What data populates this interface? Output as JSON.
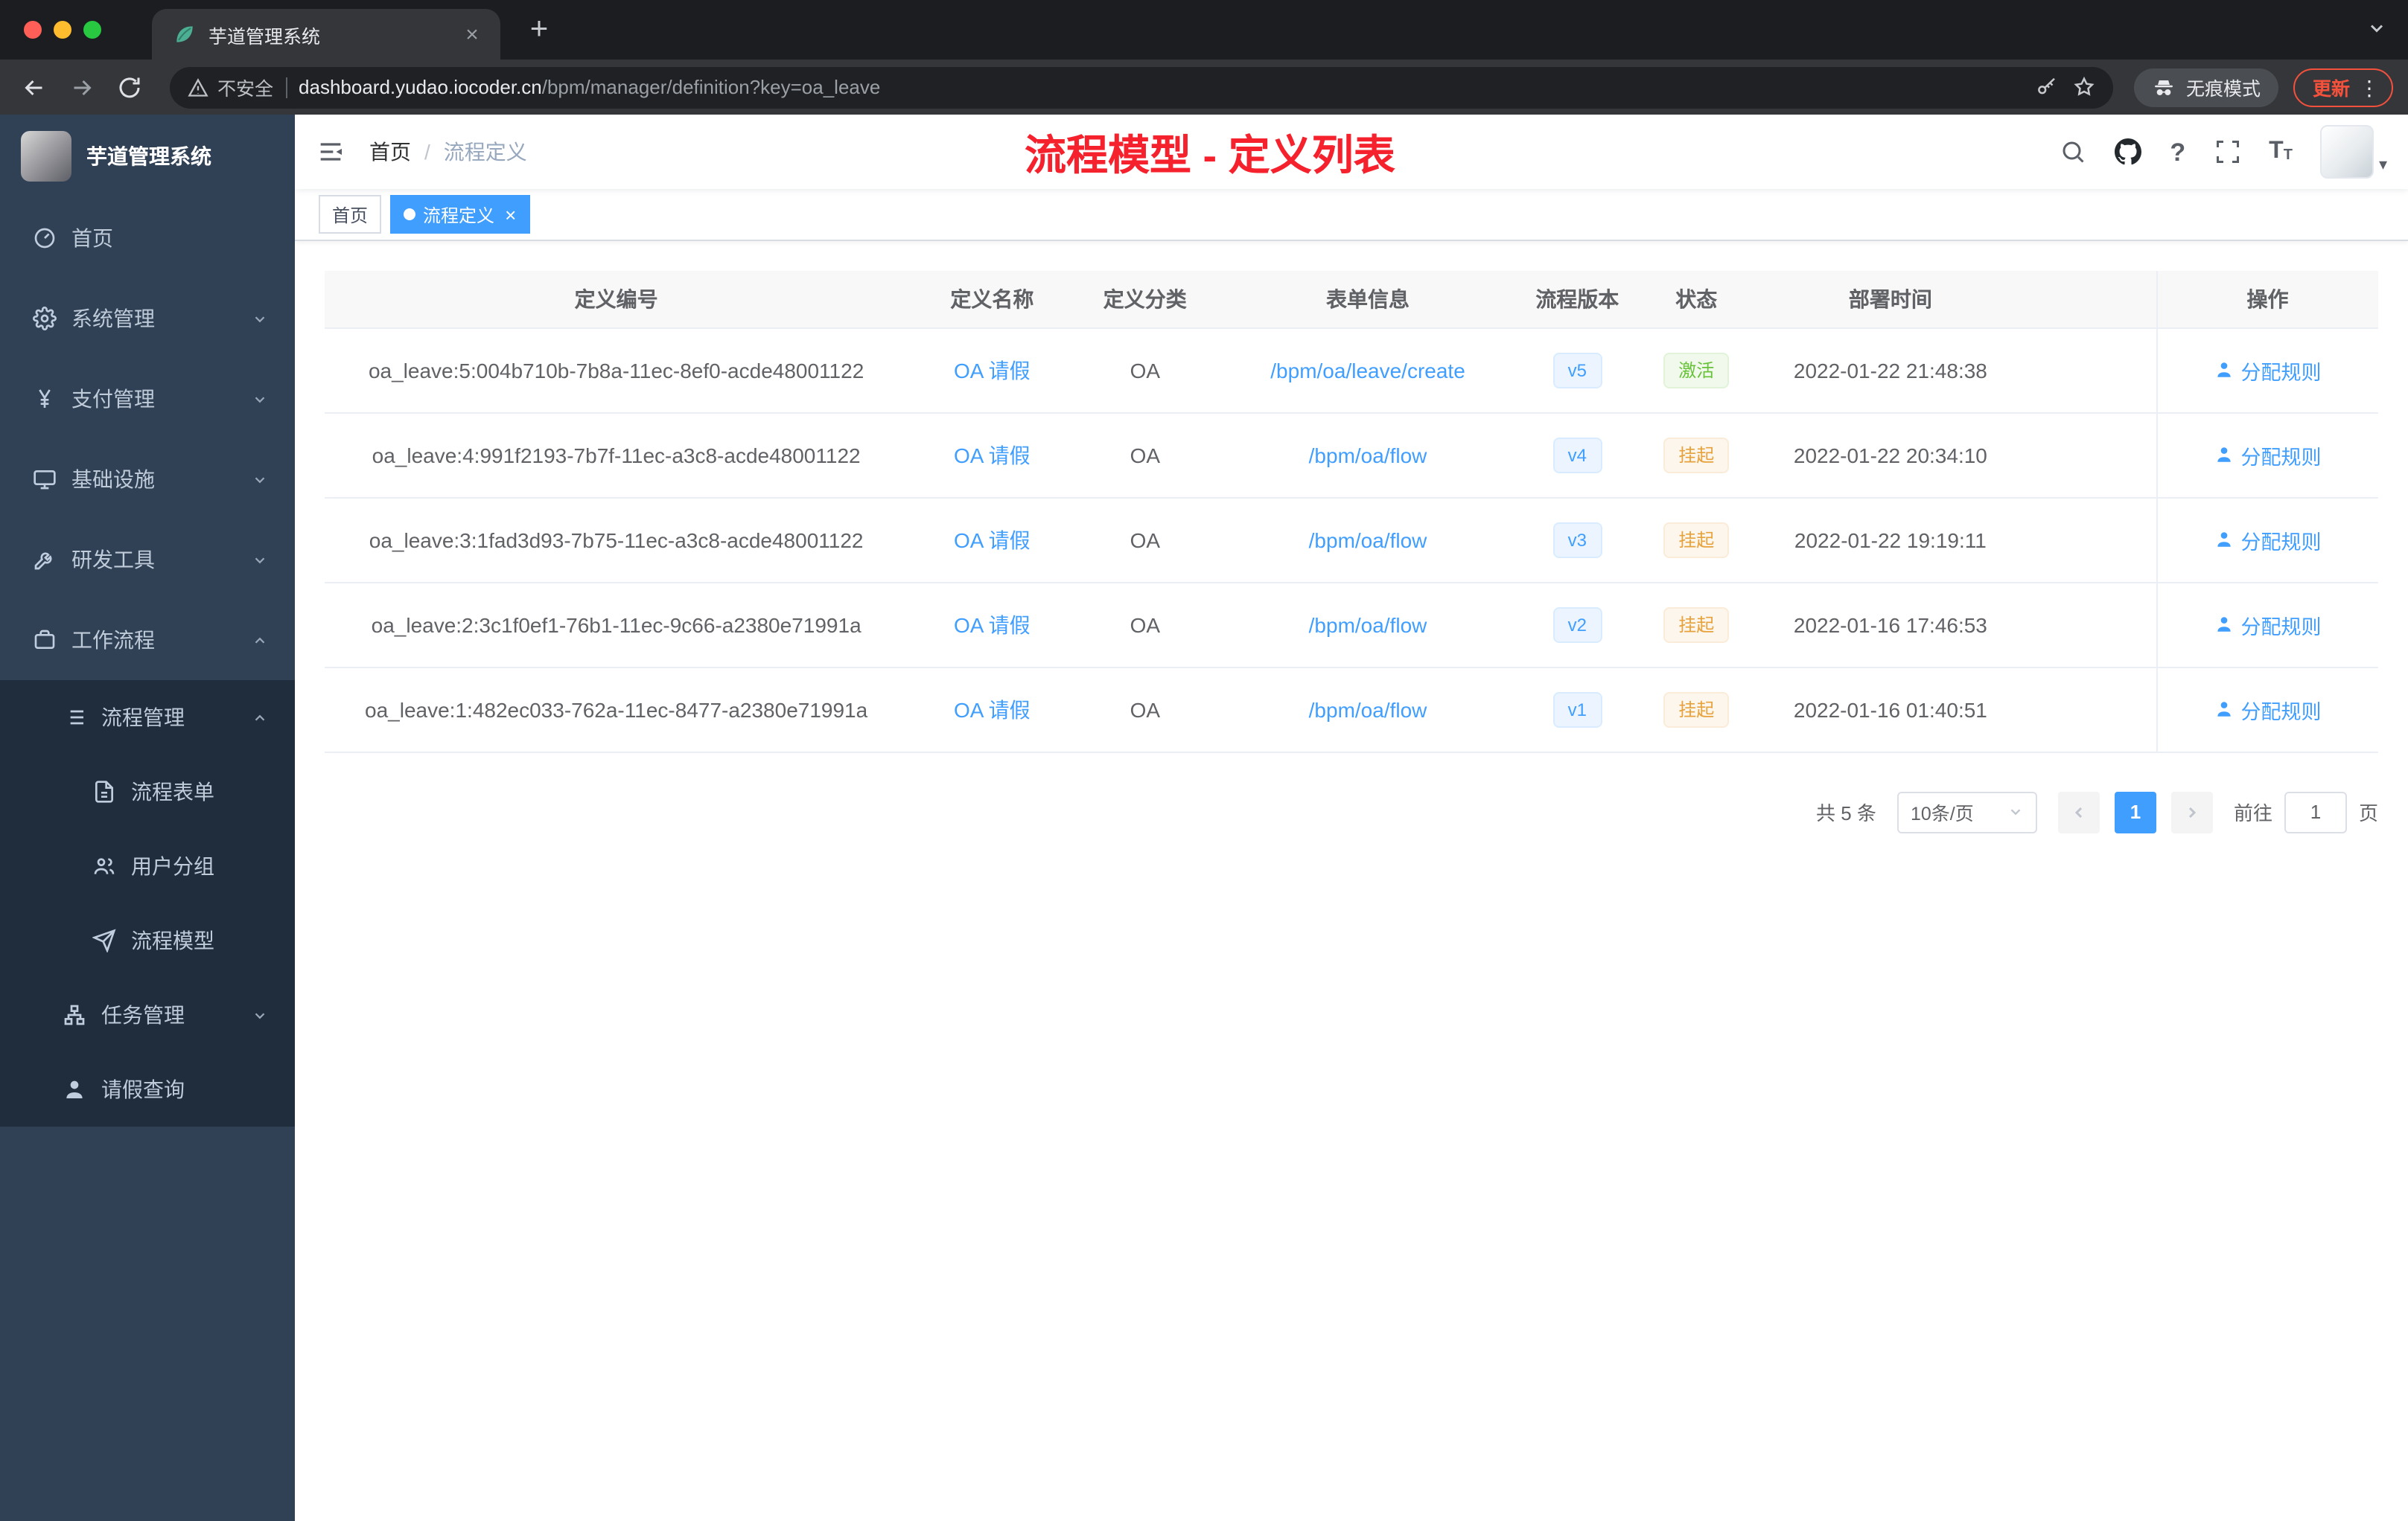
{
  "colors": {
    "accent_blue": "#409eff",
    "annotation_red": "#f5222d",
    "success_green": "#67c23a",
    "warning_orange": "#e6a23c",
    "sidebar_bg": "#304156",
    "sidebar_submenu_bg": "#1f2d3d",
    "traffic_red": "#ff5f57",
    "traffic_yellow": "#febc2e",
    "traffic_green": "#28c840"
  },
  "browser": {
    "tab_title": "芋道管理系统",
    "security_label": "不安全",
    "url_domain": "dashboard.yudao.iocoder.cn",
    "url_path": "/bpm/manager/definition?key=oa_leave",
    "incognito_label": "无痕模式",
    "update_label": "更新"
  },
  "sidebar": {
    "logo_title": "芋道管理系统",
    "items": [
      {
        "label": "首页"
      },
      {
        "label": "系统管理"
      },
      {
        "label": "支付管理"
      },
      {
        "label": "基础设施"
      },
      {
        "label": "研发工具"
      },
      {
        "label": "工作流程"
      },
      {
        "label": "流程管理"
      },
      {
        "label": "流程表单"
      },
      {
        "label": "用户分组"
      },
      {
        "label": "流程模型"
      },
      {
        "label": "任务管理"
      },
      {
        "label": "请假查询"
      }
    ]
  },
  "header": {
    "breadcrumb_home": "首页",
    "breadcrumb_separator": "/",
    "breadcrumb_current": "流程定义",
    "annotation": "流程模型 - 定义列表"
  },
  "tags_view": {
    "tags": [
      {
        "label": "首页",
        "active": false
      },
      {
        "label": "流程定义",
        "active": true
      }
    ]
  },
  "table": {
    "columns": [
      "定义编号",
      "定义名称",
      "定义分类",
      "表单信息",
      "流程版本",
      "状态",
      "部署时间",
      "操作"
    ],
    "rows": [
      {
        "id": "oa_leave:5:004b710b-7b8a-11ec-8ef0-acde48001122",
        "name": "OA 请假",
        "category": "OA",
        "form": "/bpm/oa/leave/create",
        "version": "v5",
        "status": "激活",
        "status_type": "success",
        "time": "2022-01-22 21:48:38",
        "action": "分配规则"
      },
      {
        "id": "oa_leave:4:991f2193-7b7f-11ec-a3c8-acde48001122",
        "name": "OA 请假",
        "category": "OA",
        "form": "/bpm/oa/flow",
        "version": "v4",
        "status": "挂起",
        "status_type": "warning",
        "time": "2022-01-22 20:34:10",
        "action": "分配规则"
      },
      {
        "id": "oa_leave:3:1fad3d93-7b75-11ec-a3c8-acde48001122",
        "name": "OA 请假",
        "category": "OA",
        "form": "/bpm/oa/flow",
        "version": "v3",
        "status": "挂起",
        "status_type": "warning",
        "time": "2022-01-22 19:19:11",
        "action": "分配规则"
      },
      {
        "id": "oa_leave:2:3c1f0ef1-76b1-11ec-9c66-a2380e71991a",
        "name": "OA 请假",
        "category": "OA",
        "form": "/bpm/oa/flow",
        "version": "v2",
        "status": "挂起",
        "status_type": "warning",
        "time": "2022-01-16 17:46:53",
        "action": "分配规则"
      },
      {
        "id": "oa_leave:1:482ec033-762a-11ec-8477-a2380e71991a",
        "name": "OA 请假",
        "category": "OA",
        "form": "/bpm/oa/flow",
        "version": "v1",
        "status": "挂起",
        "status_type": "warning",
        "time": "2022-01-16 01:40:51",
        "action": "分配规则"
      }
    ]
  },
  "pagination": {
    "total": "共 5 条",
    "page_size": "10条/页",
    "current_page": "1",
    "prev_symbol": "‹",
    "next_symbol": "›",
    "goto_label": "前往",
    "goto_value": "1",
    "unit_label": "页"
  }
}
